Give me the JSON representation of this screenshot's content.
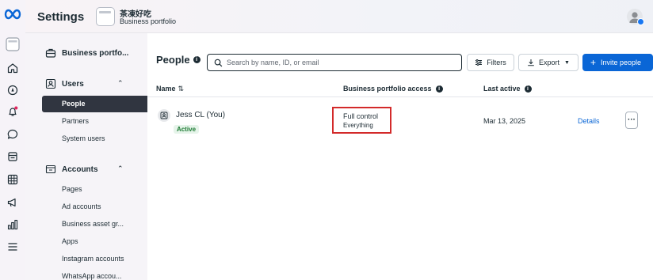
{
  "header": {
    "title": "Settings",
    "portfolio_name": "茶凍好吃",
    "portfolio_subtitle": "Business portfolio"
  },
  "sidebar": {
    "portfolio_label": "Business portfo...",
    "users_section": "Users",
    "users_items": [
      "People",
      "Partners",
      "System users"
    ],
    "accounts_section": "Accounts",
    "accounts_items": [
      "Pages",
      "Ad accounts",
      "Business asset gr...",
      "Apps",
      "Instagram accounts",
      "WhatsApp accou..."
    ],
    "active_item": "People"
  },
  "main": {
    "title": "People",
    "search_placeholder": "Search by name, ID, or email",
    "filters_label": "Filters",
    "export_label": "Export",
    "invite_label": "Invite people",
    "columns": {
      "name": "Name",
      "access": "Business portfolio access",
      "last_active": "Last active"
    },
    "rows": [
      {
        "name": "Jess CL (You)",
        "status": "Active",
        "access": "Full control",
        "access_detail": "Everything",
        "last_active": "Mar 13, 2025",
        "details_label": "Details"
      }
    ]
  },
  "colors": {
    "accent": "#0a66d6",
    "active_nav_bg": "#303540",
    "highlight_border": "#d32a2a",
    "active_badge_text": "#1e7b34"
  },
  "icons": [
    "meta-logo-icon",
    "business-portfolio-thumb-icon",
    "home-icon",
    "compass-icon",
    "notifications-icon",
    "chat-icon",
    "pages-icon",
    "table-icon",
    "megaphone-icon",
    "bar-chart-icon",
    "menu-icon",
    "briefcase-icon",
    "users-icon",
    "accounts-icon",
    "search-icon",
    "filter-icon",
    "download-icon",
    "person-icon"
  ]
}
